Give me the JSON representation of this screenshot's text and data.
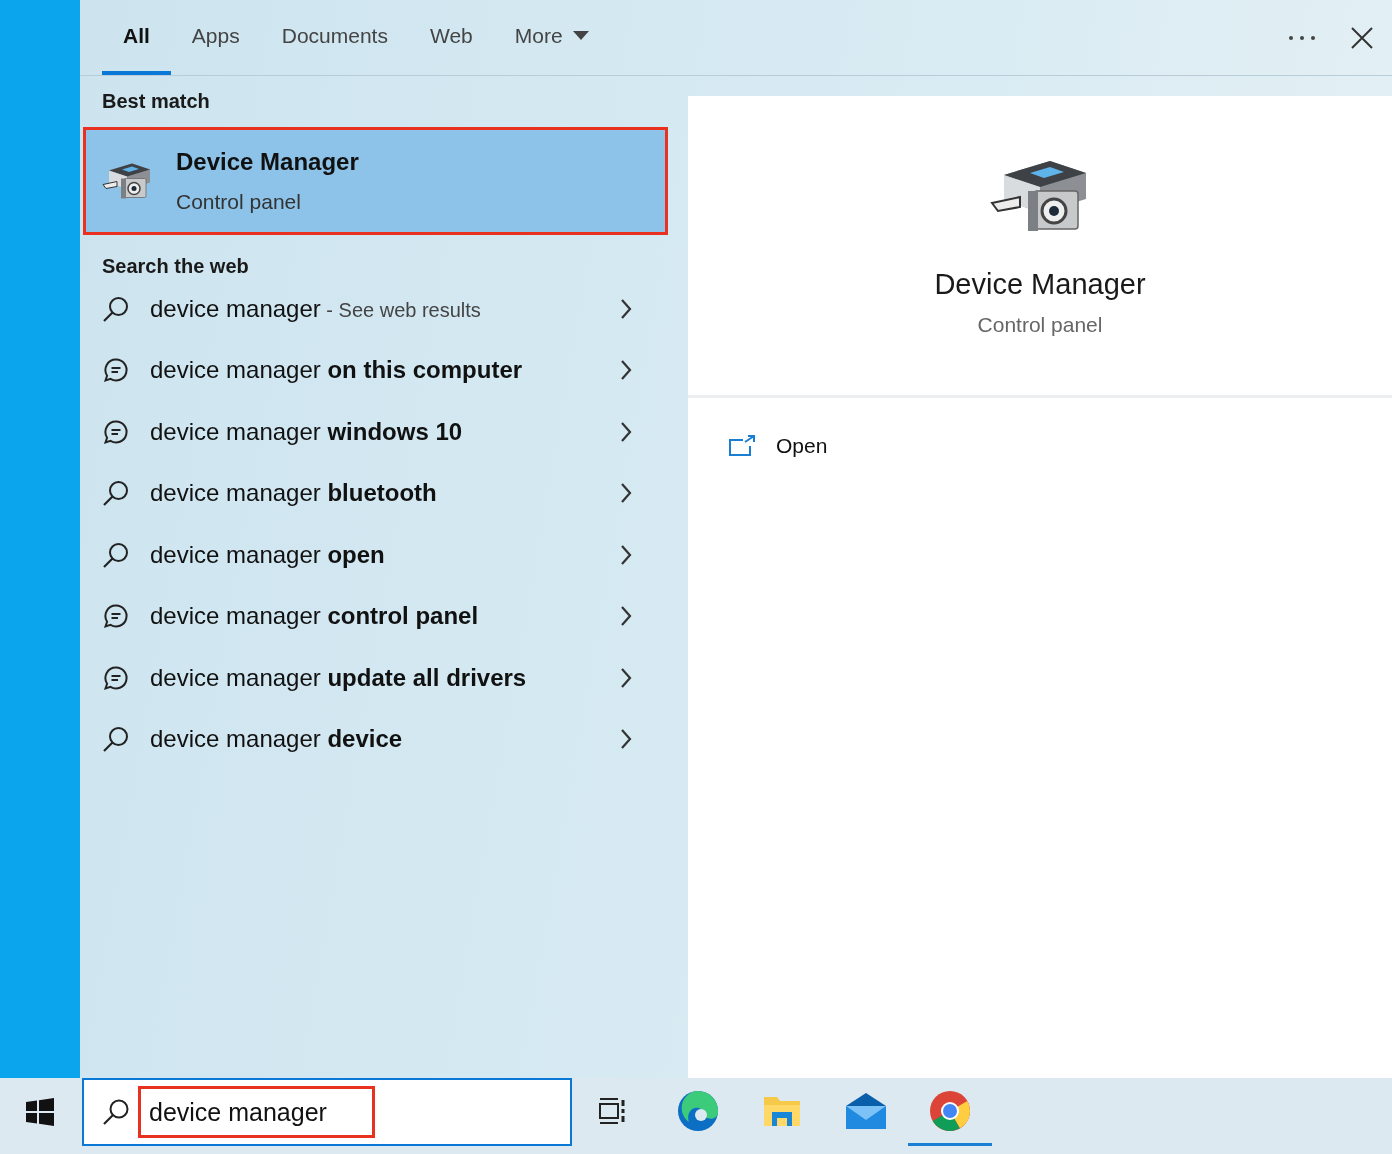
{
  "tabs": [
    {
      "label": "All",
      "selected": true,
      "dropdown": false
    },
    {
      "label": "Apps",
      "selected": false,
      "dropdown": false
    },
    {
      "label": "Documents",
      "selected": false,
      "dropdown": false
    },
    {
      "label": "Web",
      "selected": false,
      "dropdown": false
    },
    {
      "label": "More",
      "selected": false,
      "dropdown": true
    }
  ],
  "best_match": {
    "heading": "Best match",
    "title": "Device Manager",
    "subtitle": "Control panel",
    "highlighted": true
  },
  "web": {
    "heading": "Search the web",
    "items": [
      {
        "kind": "search",
        "text": "device manager",
        "hint": "- See web results"
      },
      {
        "kind": "chat",
        "text": "device manager **on this computer**"
      },
      {
        "kind": "chat",
        "text": "device manager **windows 10**"
      },
      {
        "kind": "search",
        "text": "device manager **bluetooth**"
      },
      {
        "kind": "search",
        "text": "device manager **open**"
      },
      {
        "kind": "chat",
        "text": "device manager **control panel**"
      },
      {
        "kind": "chat",
        "text": "device manager **update all drivers**"
      },
      {
        "kind": "search",
        "text": "device manager **device**"
      }
    ]
  },
  "preview": {
    "title": "Device Manager",
    "subtitle": "Control panel",
    "actions": [
      {
        "label": "Open"
      }
    ]
  },
  "taskbar": {
    "search": {
      "value": "device manager",
      "highlighted": true
    },
    "items": [
      {
        "kind": "taskview",
        "active": false
      },
      {
        "kind": "edge",
        "active": false
      },
      {
        "kind": "folder",
        "active": false
      },
      {
        "kind": "mail",
        "active": false
      },
      {
        "kind": "chrome",
        "active": true
      }
    ]
  }
}
